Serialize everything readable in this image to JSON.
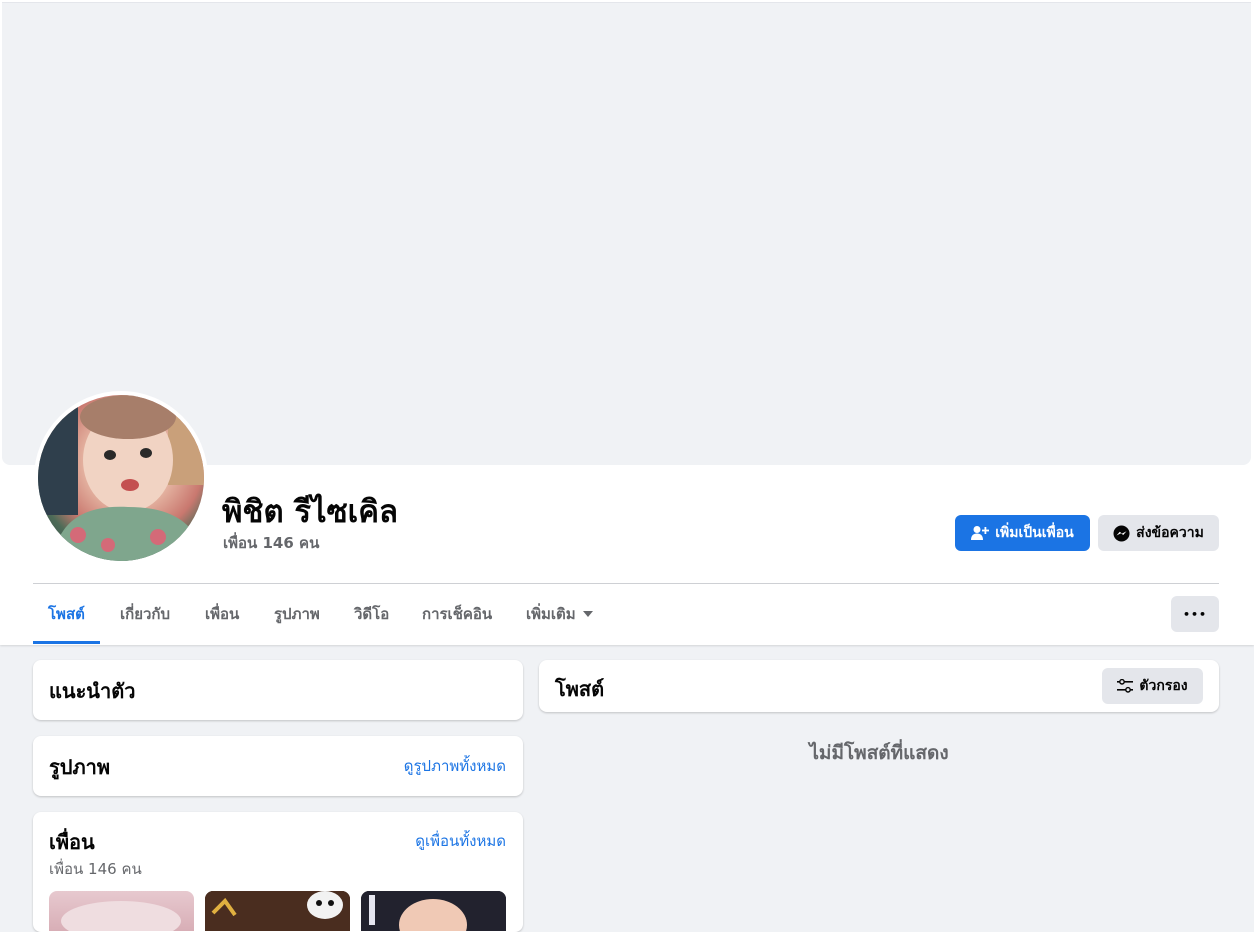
{
  "profile": {
    "name": "พิชิต รีไซเคิล",
    "friend_count": "เพื่อน 146 คน"
  },
  "actions": {
    "add_friend_label": "เพิ่มเป็นเพื่อน",
    "message_label": "ส่งข้อความ",
    "more_label": "•••"
  },
  "tabs": [
    {
      "label": "โพสต์",
      "active": true
    },
    {
      "label": "เกี่ยวกับ",
      "active": false
    },
    {
      "label": "เพื่อน",
      "active": false
    },
    {
      "label": "รูปภาพ",
      "active": false
    },
    {
      "label": "วิดีโอ",
      "active": false
    },
    {
      "label": "การเช็คอิน",
      "active": false
    },
    {
      "label": "เพิ่มเติม",
      "active": false
    }
  ],
  "intro": {
    "title": "แนะนำตัว"
  },
  "photos": {
    "title": "รูปภาพ",
    "see_all": "ดูรูปภาพทั้งหมด"
  },
  "friends": {
    "title": "เพื่อน",
    "see_all": "ดูเพื่อนทั้งหมด",
    "count": "เพื่อน 146 คน"
  },
  "posts": {
    "title": "โพสต์",
    "filter_label": "ตัวกรอง",
    "empty_message": "ไม่มีโพสต์ที่แสดง"
  },
  "icons": {
    "add_friend": "person-plus-icon",
    "message": "messenger-icon",
    "more": "ellipsis-icon",
    "dropdown": "caret-down-icon",
    "filter": "filter-sliders-icon"
  },
  "colors": {
    "accent": "#1b74e4",
    "page_bg": "#f0f2f5",
    "secondary_text": "#65676b",
    "button_gray": "#e4e6eb"
  }
}
